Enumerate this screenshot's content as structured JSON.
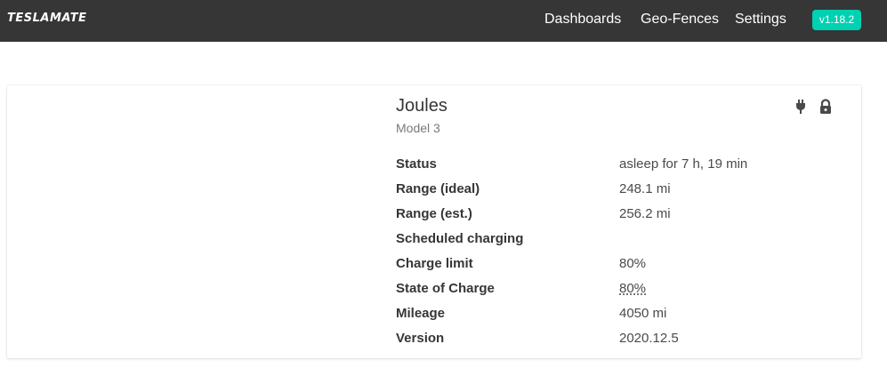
{
  "navbar": {
    "brand": "TESLAMATE",
    "items": [
      {
        "label": "Dashboards"
      },
      {
        "label": "Geo-Fences"
      },
      {
        "label": "Settings"
      }
    ],
    "version": "v1.18.2"
  },
  "car": {
    "name": "Joules",
    "model": "Model 3",
    "icons": [
      "plug-icon",
      "lock-icon"
    ],
    "rows": [
      {
        "label": "Status",
        "value": "asleep for 7 h, 19 min"
      },
      {
        "label": "Range (ideal)",
        "value": "248.1 mi"
      },
      {
        "label": "Range (est.)",
        "value": "256.2 mi"
      },
      {
        "label": "Scheduled charging",
        "value": ""
      },
      {
        "label": "Charge limit",
        "value": "80%"
      },
      {
        "label": "State of Charge",
        "value": "80%"
      },
      {
        "label": "Mileage",
        "value": "4050 mi"
      },
      {
        "label": "Version",
        "value": "2020.12.5"
      }
    ]
  },
  "colors": {
    "navbar_bg": "#363636",
    "accent": "#00d1b2"
  }
}
